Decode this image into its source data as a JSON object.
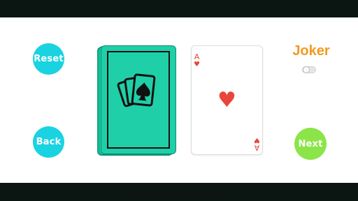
{
  "buttons": {
    "reset_label": "Reset",
    "back_label": "Back",
    "next_label": "Next"
  },
  "joker": {
    "title": "Joker",
    "toggle_on": false
  },
  "card": {
    "rank": "A",
    "suit_symbol": "♥",
    "suit_name": "hearts"
  },
  "deck": {
    "icon": "playing-cards-spade-icon"
  },
  "colors": {
    "reset_bg": "#19d3e0",
    "back_bg": "#19d3e0",
    "next_bg": "#8be548",
    "deck_bg": "#1fcfa8",
    "joker_title": "#f39a1f",
    "suit_red": "#e8463a"
  }
}
